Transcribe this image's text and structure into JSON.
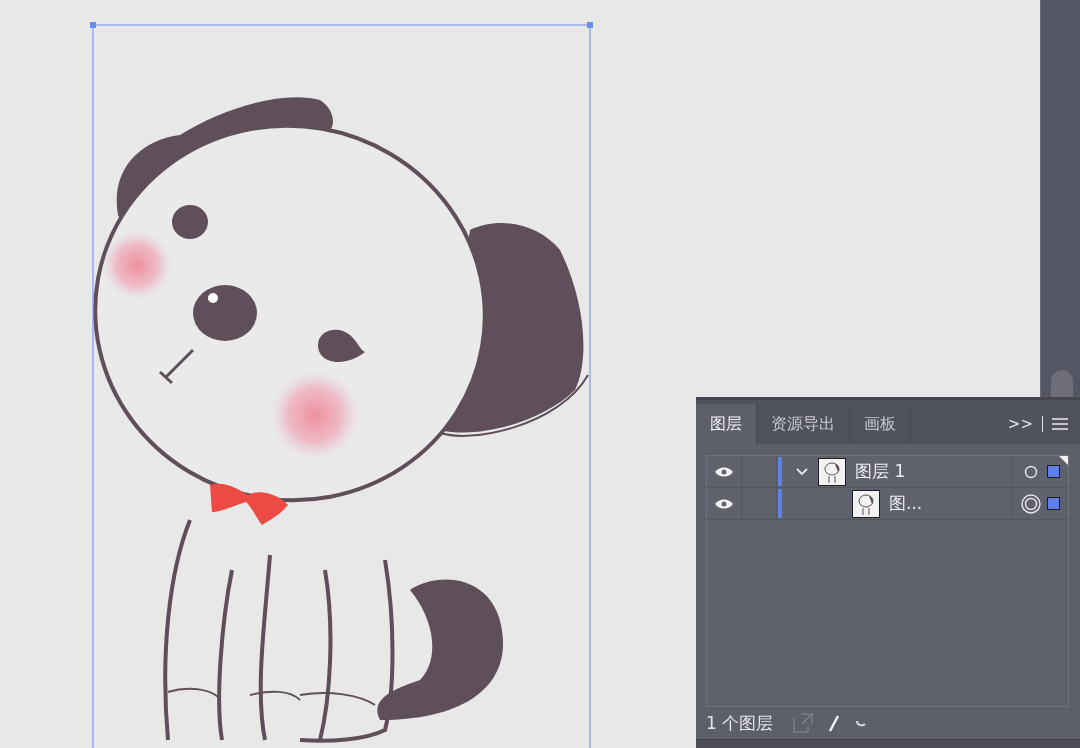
{
  "panel": {
    "tabs": [
      {
        "label": "图层",
        "selected": true
      },
      {
        "label": "资源导出",
        "selected": false
      },
      {
        "label": "画板",
        "selected": false
      }
    ],
    "overflow": ">>",
    "layers": [
      {
        "name": "图层 1",
        "visible": true,
        "expanded": true,
        "appearance": false,
        "children": [
          {
            "name": "图...",
            "visible": true,
            "appearance": true
          }
        ]
      }
    ],
    "footer": "1 个图层"
  }
}
